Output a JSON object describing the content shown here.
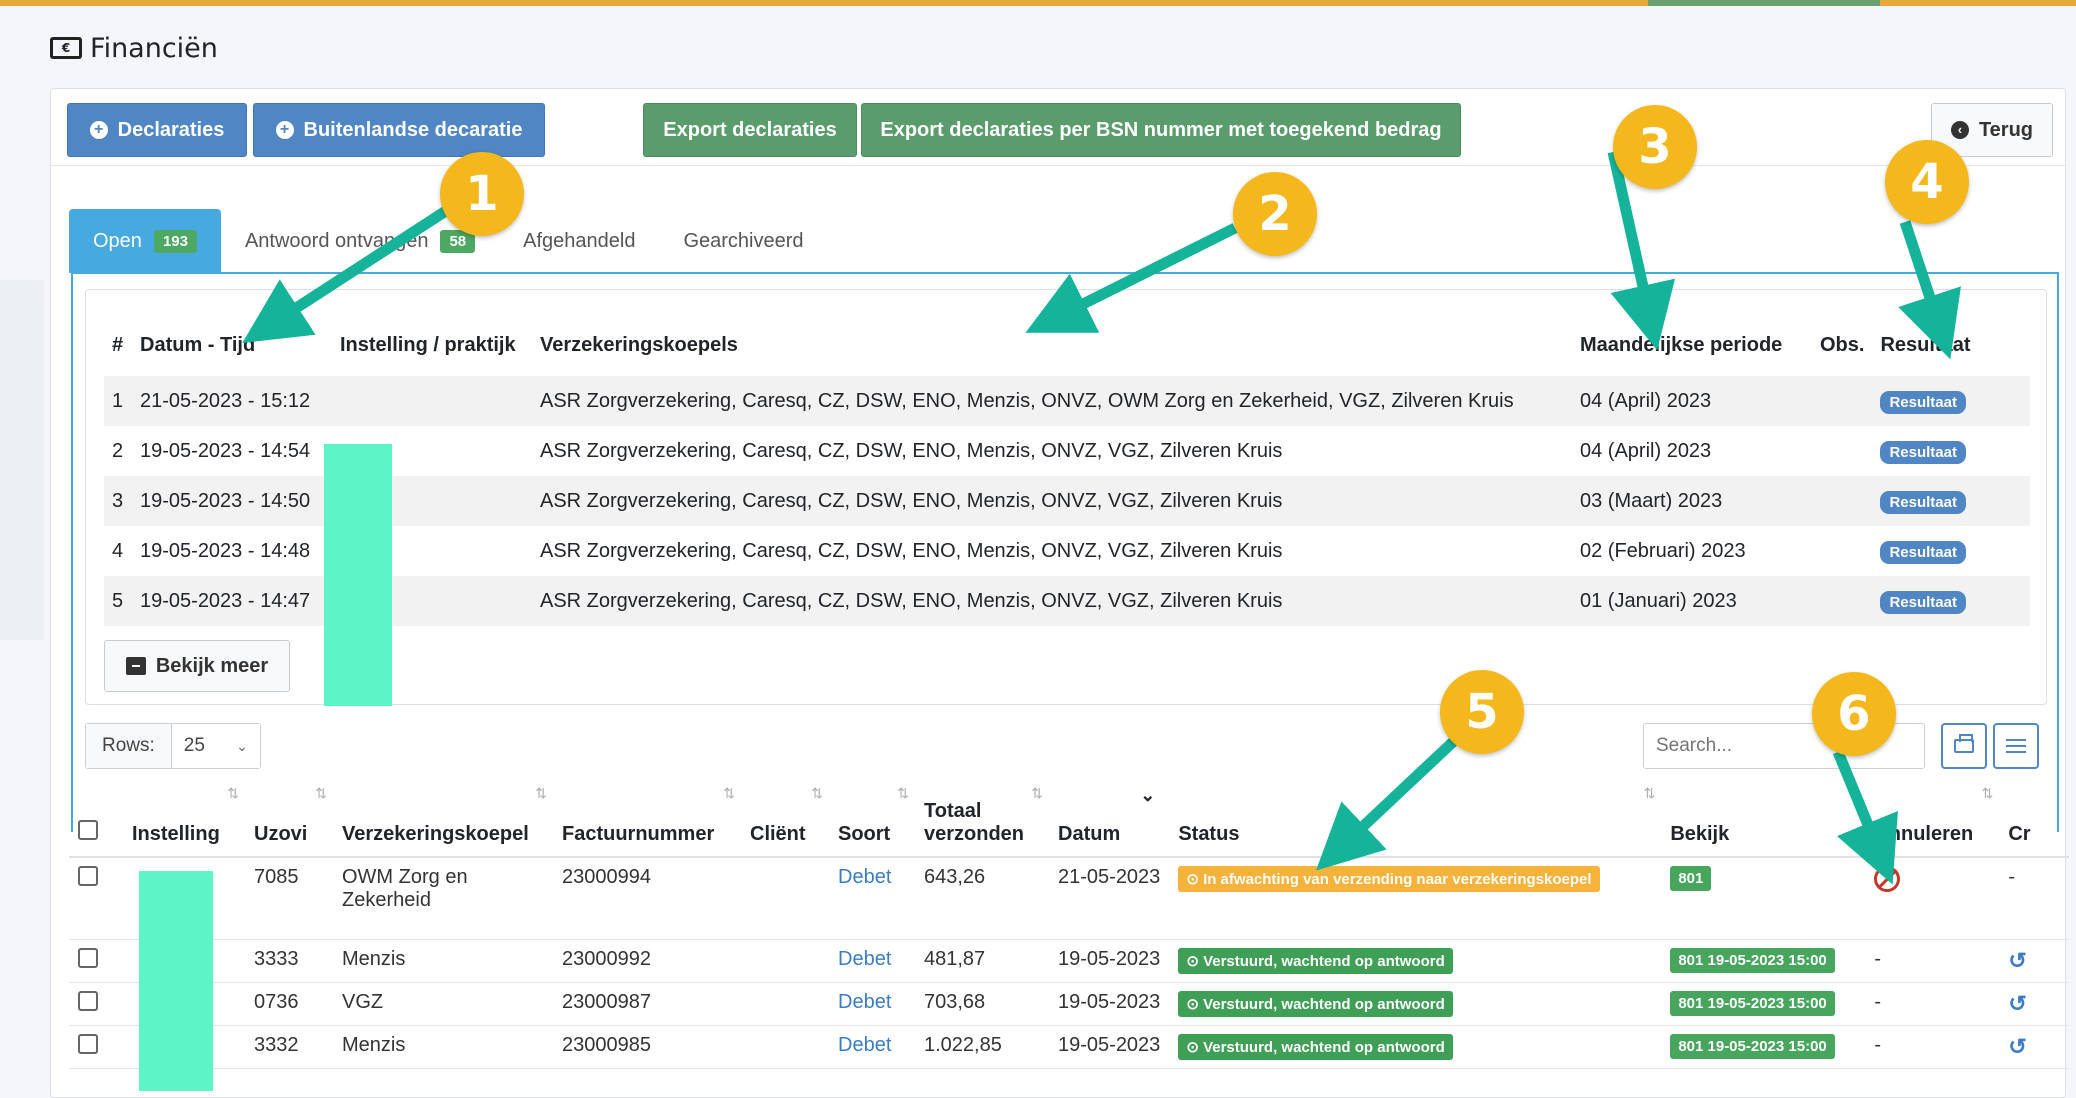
{
  "page": {
    "title": "Financiën",
    "icon": "money-bill-icon"
  },
  "toolbar": {
    "declaraties": "Declaraties",
    "buitenlandse": "Buitenlandse decaratie",
    "export": "Export declaraties",
    "export_bsn": "Export declaraties per BSN nummer met toegekend bedrag",
    "terug": "Terug"
  },
  "tabs": [
    {
      "label": "Open",
      "count": "193",
      "active": true
    },
    {
      "label": "Antwoord ontvangen",
      "count": "58"
    },
    {
      "label": "Afgehandeld"
    },
    {
      "label": "Gearchiveerd"
    }
  ],
  "overview": {
    "headers": [
      "#",
      "Datum - Tijd",
      "Instelling / praktijk",
      "Verzekeringskoepels",
      "Maandelijkse periode",
      "Obs.",
      "Resultaat"
    ],
    "rows": [
      {
        "n": "1",
        "datum": "21-05-2023 - 15:12",
        "koepels": "ASR Zorgverzekering, Caresq, CZ, DSW, ENO, Menzis, ONVZ, OWM Zorg en Zekerheid, VGZ, Zilveren Kruis",
        "periode": "04 (April) 2023",
        "resultaat": "Resultaat"
      },
      {
        "n": "2",
        "datum": "19-05-2023 - 14:54",
        "koepels": "ASR Zorgverzekering, Caresq, CZ, DSW, ENO, Menzis, ONVZ, VGZ, Zilveren Kruis",
        "periode": "04 (April) 2023",
        "resultaat": "Resultaat"
      },
      {
        "n": "3",
        "datum": "19-05-2023 - 14:50",
        "koepels": "ASR Zorgverzekering, Caresq, CZ, DSW, ENO, Menzis, ONVZ, VGZ, Zilveren Kruis",
        "periode": "03 (Maart) 2023",
        "resultaat": "Resultaat"
      },
      {
        "n": "4",
        "datum": "19-05-2023 - 14:48",
        "koepels": "ASR Zorgverzekering, Caresq, CZ, DSW, ENO, Menzis, ONVZ, VGZ, Zilveren Kruis",
        "periode": "02 (Februari) 2023",
        "resultaat": "Resultaat"
      },
      {
        "n": "5",
        "datum": "19-05-2023 - 14:47",
        "koepels": "ASR Zorgverzekering, Caresq, CZ, DSW, ENO, Menzis, ONVZ, VGZ, Zilveren Kruis",
        "periode": "01 (Januari) 2023",
        "resultaat": "Resultaat"
      }
    ],
    "more": "Bekijk meer"
  },
  "controls": {
    "rows_label": "Rows:",
    "rows_value": "25",
    "search_placeholder": "Search..."
  },
  "main": {
    "headers": {
      "instelling": "Instelling",
      "uzovi": "Uzovi",
      "koepel": "Verzekeringskoepel",
      "factuur": "Factuurnummer",
      "client": "Cliënt",
      "soort": "Soort",
      "totaal1": "Totaal",
      "totaal2": "verzonden",
      "datum": "Datum",
      "status": "Status",
      "bekijk": "Bekijk",
      "annuleren": "Annuleren",
      "cr": "Cr"
    },
    "rows": [
      {
        "uzovi": "7085",
        "koepel": "OWM Zorg en Zekerheid",
        "factuur": "23000994",
        "soort": "Debet",
        "totaal": "643,26",
        "datum": "21-05-2023",
        "status": "In afwachting van verzending naar verzekeringskoepel",
        "status_type": "pending",
        "bekijk": "801",
        "annuleren": "",
        "cr": "-"
      },
      {
        "uzovi": "3333",
        "koepel": "Menzis",
        "factuur": "23000992",
        "soort": "Debet",
        "totaal": "481,87",
        "datum": "19-05-2023",
        "status": "Verstuurd, wachtend op antwoord",
        "status_type": "sent",
        "bekijk": "801 19-05-2023 15:00",
        "annuleren": "-",
        "cr": ""
      },
      {
        "uzovi": "0736",
        "koepel": "VGZ",
        "factuur": "23000987",
        "soort": "Debet",
        "totaal": "703,68",
        "datum": "19-05-2023",
        "status": "Verstuurd, wachtend op antwoord",
        "status_type": "sent",
        "bekijk": "801 19-05-2023 15:00",
        "annuleren": "-",
        "cr": ""
      },
      {
        "uzovi": "3332",
        "koepel": "Menzis",
        "factuur": "23000985",
        "soort": "Debet",
        "totaal": "1.022,85",
        "datum": "19-05-2023",
        "status": "Verstuurd, wachtend op antwoord",
        "status_type": "sent",
        "bekijk": "801 19-05-2023 15:00",
        "annuleren": "-",
        "cr": ""
      }
    ]
  },
  "markers": [
    "1",
    "2",
    "3",
    "4",
    "5",
    "6"
  ],
  "colors": {
    "accent_blue": "#4f86c3",
    "green": "#5a9c6b",
    "marker": "#f4b81c",
    "arrow": "#16b39b",
    "redaction": "#5cf5c5"
  }
}
